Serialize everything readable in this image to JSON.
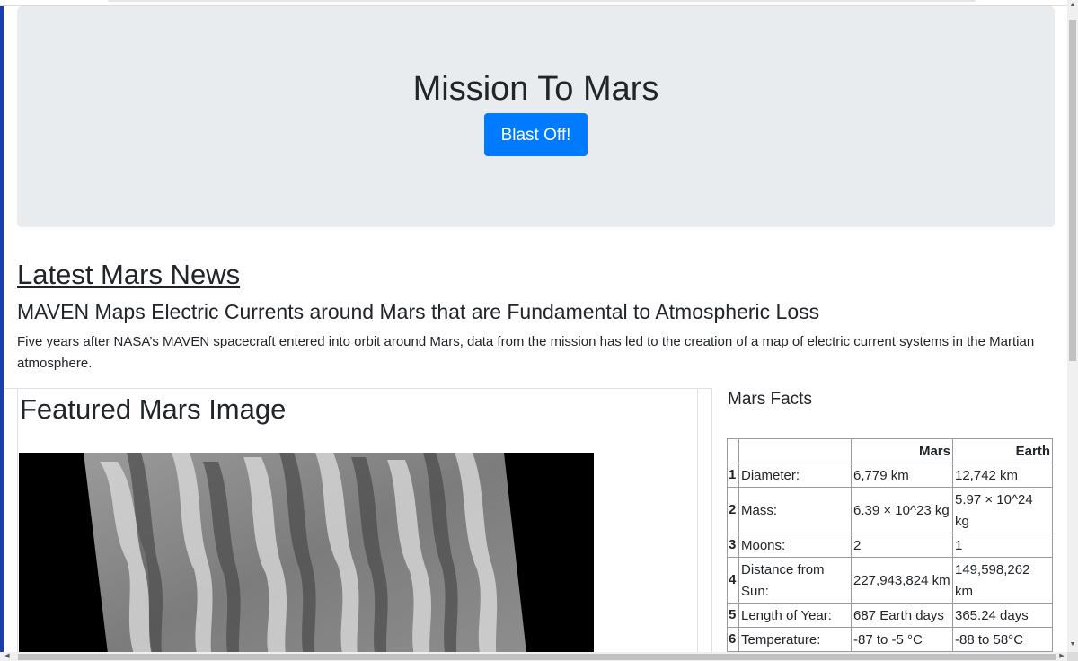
{
  "jumbotron": {
    "title": "Mission To Mars",
    "button_label": "Blast Off!"
  },
  "news": {
    "heading": "Latest Mars News",
    "title": "MAVEN Maps Electric Currents around Mars that are Fundamental to Atmospheric Loss",
    "teaser": "Five years after NASA’s MAVEN spacecraft entered into orbit around Mars, data from the mission has led to the creation of a map of electric current systems in the Martian atmosphere."
  },
  "featured": {
    "heading": "Featured Mars Image"
  },
  "facts": {
    "heading": "Mars Facts",
    "columns": [
      "",
      "",
      "Mars",
      "Earth"
    ],
    "rows": [
      {
        "index": "1",
        "label": "Diameter:",
        "mars": "6,779 km",
        "earth": "12,742 km"
      },
      {
        "index": "2",
        "label": "Mass:",
        "mars": "6.39 × 10^23 kg",
        "earth": "5.97 × 10^24 kg"
      },
      {
        "index": "3",
        "label": "Moons:",
        "mars": "2",
        "earth": "1"
      },
      {
        "index": "4",
        "label": "Distance from Sun:",
        "mars": "227,943,824 km",
        "earth": "149,598,262 km"
      },
      {
        "index": "5",
        "label": "Length of Year:",
        "mars": "687 Earth days",
        "earth": "365.24 days"
      },
      {
        "index": "6",
        "label": "Temperature:",
        "mars": "-87 to -5 °C",
        "earth": "-88 to 58°C"
      }
    ]
  },
  "colors": {
    "primary_button": "#007bff",
    "jumbotron_bg": "#e9ecef"
  },
  "icons": {
    "scroll_up": "scroll-up-arrow-icon",
    "scroll_down": "scroll-down-arrow-icon",
    "scroll_left": "scroll-left-arrow-icon",
    "scroll_right": "scroll-right-arrow-icon"
  }
}
